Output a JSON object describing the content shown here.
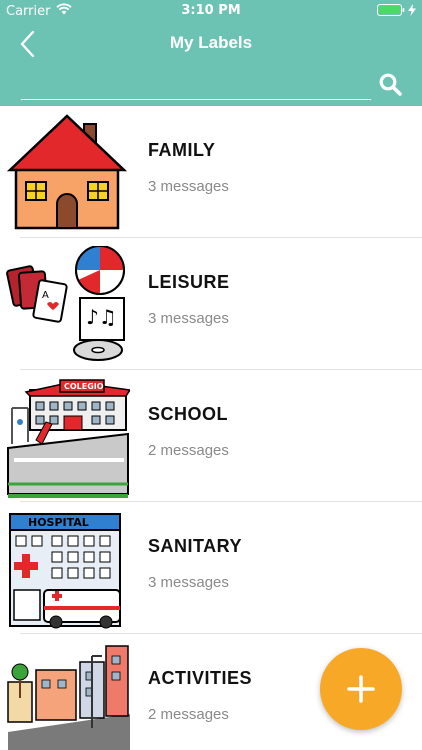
{
  "status_bar": {
    "carrier": "Carrier",
    "time": "3:10 PM",
    "wifi_icon": "wifi-icon",
    "battery_icon": "battery-icon"
  },
  "nav": {
    "title": "My Labels",
    "back_icon": "chevron-left-icon"
  },
  "search": {
    "value": "",
    "placeholder": "",
    "icon": "search-icon"
  },
  "labels": [
    {
      "name": "FAMILY",
      "count": "3 messages",
      "icon": "house-icon"
    },
    {
      "name": "LEISURE",
      "count": "3 messages",
      "icon": "leisure-icon"
    },
    {
      "name": "SCHOOL",
      "count": "2 messages",
      "icon": "school-icon"
    },
    {
      "name": "SANITARY",
      "count": "3 messages",
      "icon": "hospital-icon"
    },
    {
      "name": "ACTIVITIES",
      "count": "2 messages",
      "icon": "street-icon"
    }
  ],
  "fab": {
    "icon": "plus-icon"
  },
  "colors": {
    "header": "#6cc3b4",
    "fab": "#f7a826",
    "title_text": "#111111",
    "count_text": "#8a8a8a"
  }
}
